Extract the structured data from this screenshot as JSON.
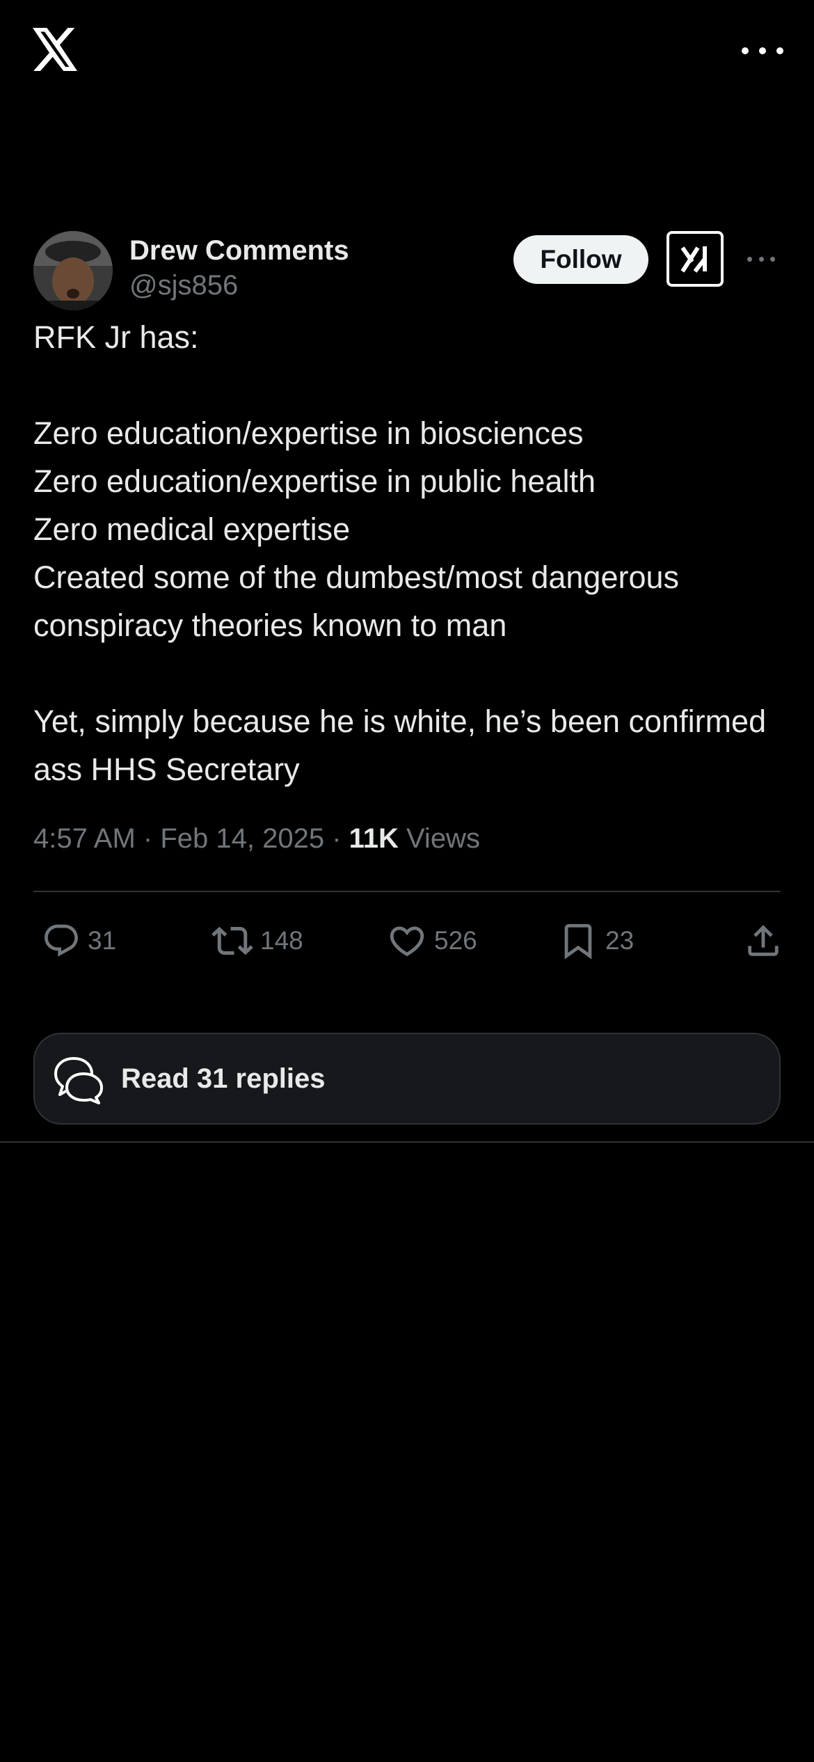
{
  "colors": {
    "background": "#000000",
    "text_primary": "#e7e9ea",
    "text_secondary": "#71767b",
    "follow_button_bg": "#eff3f4",
    "divider": "#2f3336"
  },
  "header": {
    "logo_icon": "x-logo-icon",
    "more_icon": "more-horizontal-icon"
  },
  "post": {
    "author": {
      "display_name": "Drew Comments",
      "handle": "@sjs856",
      "avatar_icon": "avatar"
    },
    "follow_label": "Follow",
    "grok_icon": "grok-icon",
    "more_icon": "more-horizontal-icon",
    "text": "RFK Jr has:\n\nZero education/expertise in biosciences\nZero education/expertise in public health\nZero medical expertise\nCreated some of the dumbest/most dangerous conspiracy theories known to man\n\nYet, simply because he is white, he’s been confirmed ass HHS Secretary",
    "time": "4:57 AM",
    "separator": "·",
    "date": "Feb 14, 2025",
    "views_count": "11K",
    "views_label": "Views"
  },
  "actions": {
    "replies": {
      "icon": "reply-icon",
      "count": "31"
    },
    "reposts": {
      "icon": "repost-icon",
      "count": "148"
    },
    "likes": {
      "icon": "like-icon",
      "count": "526"
    },
    "bookmarks": {
      "icon": "bookmark-icon",
      "count": "23"
    },
    "share": {
      "icon": "share-icon"
    }
  },
  "read_replies": {
    "icon": "replies-bubble-icon",
    "label": "Read 31 replies"
  }
}
